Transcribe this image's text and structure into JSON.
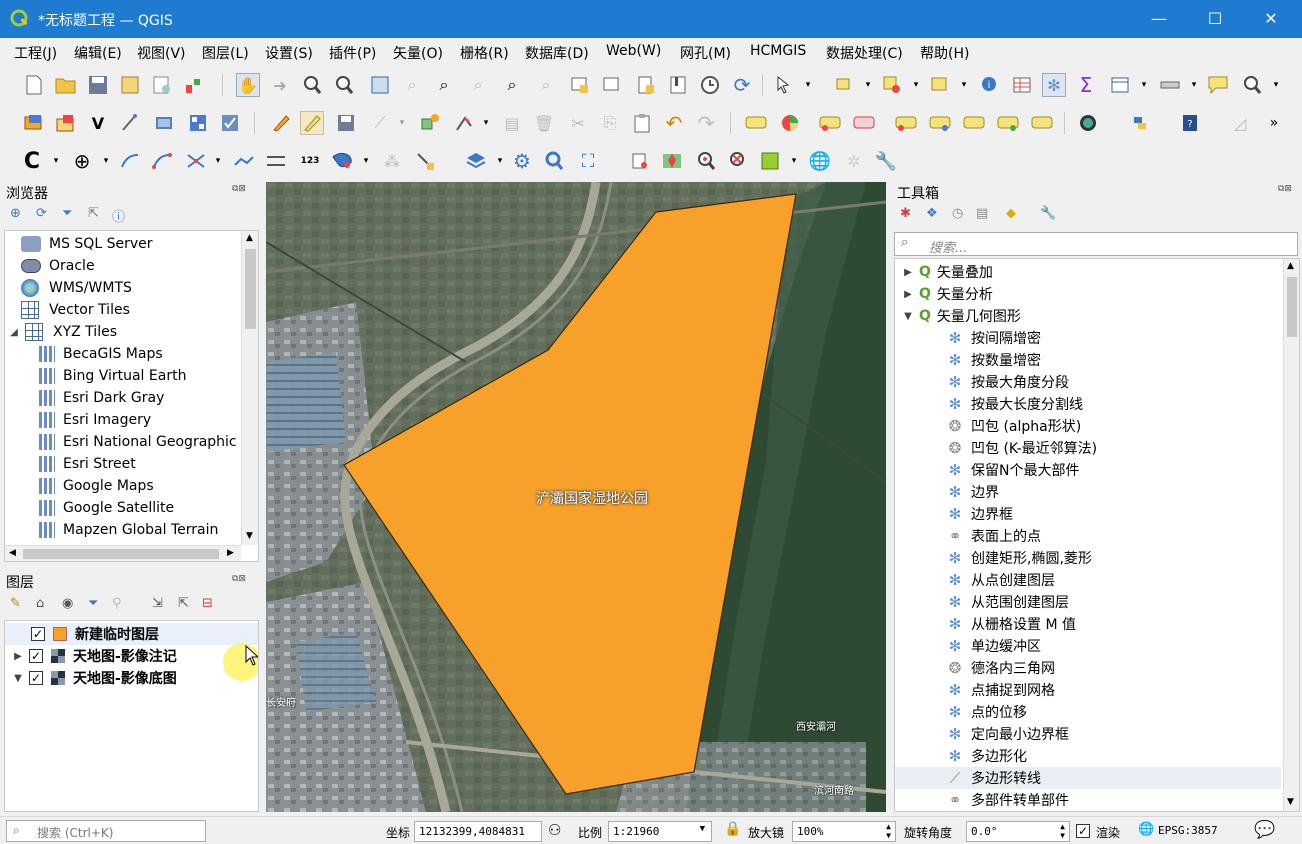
{
  "window": {
    "title": "*无标题工程 — QGIS",
    "minimize": "—",
    "maximize": "☐",
    "close": "✕"
  },
  "menu": [
    "工程(J)",
    "编辑(E)",
    "视图(V)",
    "图层(L)",
    "设置(S)",
    "插件(P)",
    "矢量(O)",
    "栅格(R)",
    "数据库(D)",
    "Web(W)",
    "网孔(M)",
    "HCMGIS",
    "数据处理(C)",
    "帮助(H)"
  ],
  "browser": {
    "title": "浏览器",
    "items": [
      {
        "label": "MS SQL Server",
        "icon": "mssql-icon"
      },
      {
        "label": "Oracle",
        "icon": "oracle-icon"
      },
      {
        "label": "WMS/WMTS",
        "icon": "globe-icon"
      },
      {
        "label": "Vector Tiles",
        "icon": "vector-tiles-icon"
      },
      {
        "label": "XYZ Tiles",
        "icon": "xyz-tiles-icon"
      },
      {
        "label": "BecaGIS Maps",
        "icon": "tile-grid-icon"
      },
      {
        "label": "Bing Virtual Earth",
        "icon": "tile-grid-icon"
      },
      {
        "label": "Esri Dark Gray",
        "icon": "tile-grid-icon"
      },
      {
        "label": "Esri Imagery",
        "icon": "tile-grid-icon"
      },
      {
        "label": "Esri National Geographic",
        "icon": "tile-grid-icon"
      },
      {
        "label": "Esri Street",
        "icon": "tile-grid-icon"
      },
      {
        "label": "Google Maps",
        "icon": "tile-grid-icon"
      },
      {
        "label": "Google Satellite",
        "icon": "tile-grid-icon"
      },
      {
        "label": "Mapzen Global Terrain",
        "icon": "tile-grid-icon"
      }
    ]
  },
  "layers": {
    "title": "图层",
    "items": [
      {
        "label": "新建临时图层",
        "checked": "✓"
      },
      {
        "label": "天地图-影像注记",
        "checked": "✓"
      },
      {
        "label": "天地图-影像底图",
        "checked": "✓"
      }
    ]
  },
  "map": {
    "polygon_label": "浐灞国家湿地公园",
    "polygon_fill": "#f7a12a",
    "map_text_1": "西安灞河",
    "map_text_2": "滨河南路",
    "map_text_3": "长安府"
  },
  "toolbox": {
    "title": "工具箱",
    "search_placeholder": "搜索...",
    "groups": [
      "矢量叠加",
      "矢量分析",
      "矢量几何图形"
    ],
    "tools": [
      "按间隔增密",
      "按数量增密",
      "按最大角度分段",
      "按最大长度分割线",
      "凹包 (alpha形状)",
      "凹包 (K-最近邻算法)",
      "保留N个最大部件",
      "边界",
      "边界框",
      "表面上的点",
      "创建矩形,椭圆,菱形",
      "从点创建图层",
      "从范围创建图层",
      "从栅格设置 M 值",
      "单边缓冲区",
      "德洛内三角网",
      "点捕捉到网格",
      "点的位移",
      "定向最小边界框",
      "多边形化",
      "多边形转线",
      "多部件转单部件"
    ]
  },
  "statusbar": {
    "search_placeholder": "搜索 (Ctrl+K)",
    "coord_label": "坐标",
    "coord_value": "12132399,4084831",
    "scale_label": "比例",
    "scale_value": "1:21960",
    "magnifier_label": "放大镜",
    "magnifier_value": "100%",
    "rotation_label": "旋转角度",
    "rotation_value": "0.0°",
    "render_label": "渲染",
    "render_checked": "✓",
    "crs": "EPSG:3857"
  }
}
